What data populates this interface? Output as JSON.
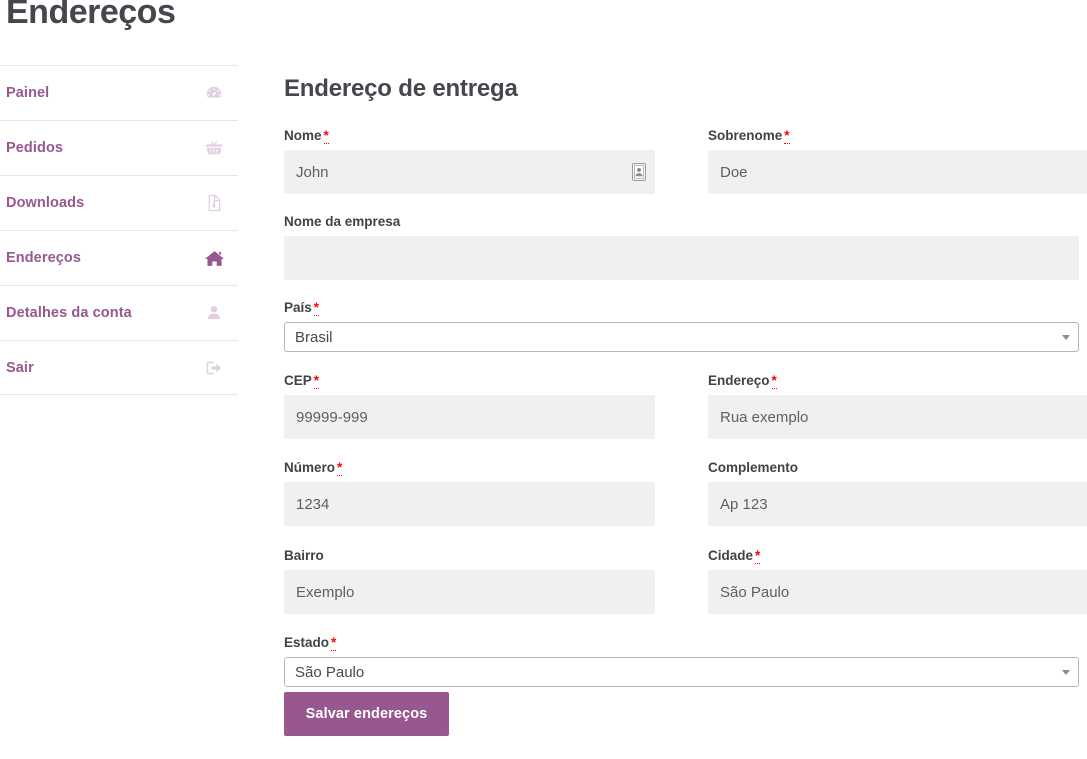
{
  "page": {
    "title": "Endereços"
  },
  "sidebar": {
    "items": [
      {
        "label": "Painel",
        "icon": "dashboard-icon",
        "active": false
      },
      {
        "label": "Pedidos",
        "icon": "basket-icon",
        "active": false
      },
      {
        "label": "Downloads",
        "icon": "file-download-icon",
        "active": false
      },
      {
        "label": "Endereços",
        "icon": "home-icon",
        "active": true
      },
      {
        "label": "Detalhes da conta",
        "icon": "user-icon",
        "active": false
      },
      {
        "label": "Sair",
        "icon": "sign-out-icon",
        "active": false
      }
    ]
  },
  "form": {
    "heading": "Endereço de entrega",
    "required_marker": "*",
    "fields": {
      "first_name": {
        "label": "Nome",
        "required": true,
        "value": "John",
        "placeholder": ""
      },
      "last_name": {
        "label": "Sobrenome",
        "required": true,
        "value": "Doe",
        "placeholder": ""
      },
      "company": {
        "label": "Nome da empresa",
        "required": false,
        "value": "",
        "placeholder": ""
      },
      "country": {
        "label": "País",
        "required": true,
        "value": "Brasil",
        "options": [
          "Brasil"
        ]
      },
      "postcode": {
        "label": "CEP",
        "required": true,
        "value": "",
        "placeholder": "99999-999"
      },
      "address": {
        "label": "Endereço",
        "required": true,
        "value": "",
        "placeholder": "Rua exemplo"
      },
      "number": {
        "label": "Número",
        "required": true,
        "value": "",
        "placeholder": "1234"
      },
      "complement": {
        "label": "Complemento",
        "required": false,
        "value": "",
        "placeholder": "Ap 123"
      },
      "neighborhood": {
        "label": "Bairro",
        "required": false,
        "value": "",
        "placeholder": "Exemplo"
      },
      "city": {
        "label": "Cidade",
        "required": true,
        "value": "",
        "placeholder": "São Paulo"
      },
      "state": {
        "label": "Estado",
        "required": true,
        "value": "São Paulo",
        "options": [
          "São Paulo"
        ]
      }
    },
    "submit_label": "Salvar endereços"
  },
  "colors": {
    "accent": "#96588f",
    "accent_light": "#e3cfe0",
    "heading": "#45474d",
    "input_bg": "#f0f0f0",
    "required": "#ff0000"
  }
}
